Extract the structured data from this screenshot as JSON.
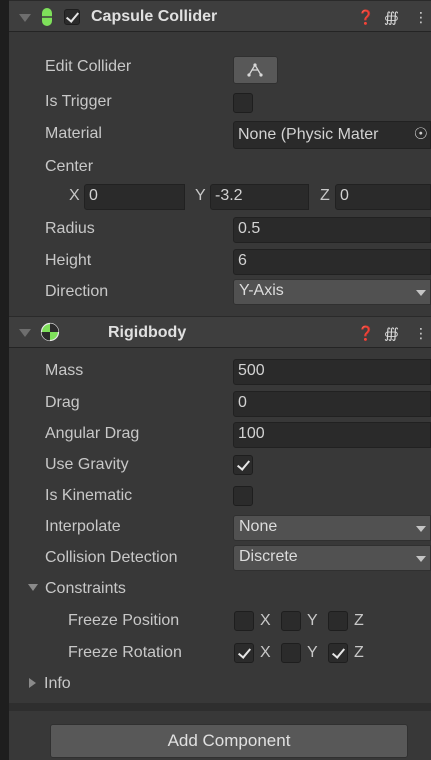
{
  "capsule": {
    "title": "Capsule Collider",
    "rows": {
      "edit_collider": "Edit Collider",
      "is_trigger": "Is Trigger",
      "material": "Material",
      "material_value": "None (Physic Mater",
      "center": "Center",
      "center_x_label": "X",
      "center_x": "0",
      "center_y_label": "Y",
      "center_y": "-3.2",
      "center_z_label": "Z",
      "center_z": "0",
      "radius": "Radius",
      "radius_value": "0.5",
      "height": "Height",
      "height_value": "6",
      "direction": "Direction",
      "direction_value": "Y-Axis"
    },
    "enabled": true
  },
  "rigidbody": {
    "title": "Rigidbody",
    "mass": "Mass",
    "mass_value": "500",
    "drag": "Drag",
    "drag_value": "0",
    "angular_drag": "Angular Drag",
    "angular_drag_value": "100",
    "use_gravity": "Use Gravity",
    "use_gravity_checked": true,
    "is_kinematic": "Is Kinematic",
    "is_kinematic_checked": false,
    "interpolate": "Interpolate",
    "interpolate_value": "None",
    "collision_detection": "Collision Detection",
    "collision_detection_value": "Discrete",
    "constraints": "Constraints",
    "freeze_position": "Freeze Position",
    "freeze_rotation": "Freeze Rotation",
    "axis_x": "X",
    "axis_y": "Y",
    "axis_z": "Z",
    "freeze_position_checked": {
      "x": false,
      "y": false,
      "z": false
    },
    "freeze_rotation_checked": {
      "x": true,
      "y": false,
      "z": true
    },
    "info": "Info"
  },
  "footer": {
    "add_component": "Add Component"
  },
  "colors": {
    "capsule_icon": "#7ee05a",
    "panel_bg": "#383838",
    "field_bg": "#2a2a2a"
  },
  "icons": [
    "help-icon",
    "preset-icon",
    "kebab-menu-icon",
    "edit-collider-icon",
    "rigidbody-icon",
    "capsule-collider-icon",
    "object-picker-icon"
  ]
}
